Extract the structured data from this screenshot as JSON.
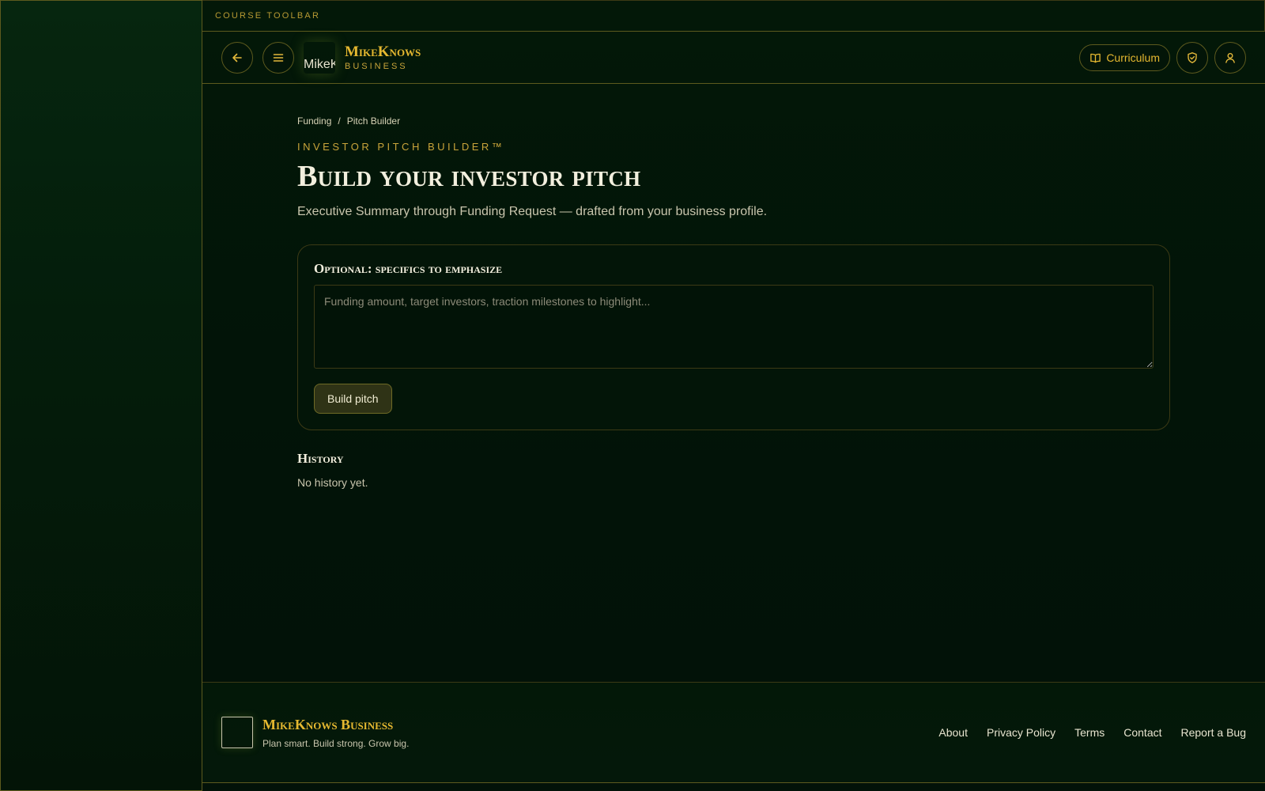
{
  "toolbar": {
    "label": "COURSE TOOLBAR"
  },
  "header": {
    "logo_alt": "MikeKnows",
    "brand_name": "MikeKnows",
    "brand_sub": "BUSINESS",
    "curriculum_label": "Curriculum",
    "icons": [
      "arrow-left-icon",
      "menu-icon",
      "book-icon",
      "shield-check-icon",
      "user-icon"
    ]
  },
  "breadcrumb": {
    "items": [
      "Funding",
      "Pitch Builder"
    ],
    "separator": "/"
  },
  "page": {
    "eyebrow": "INVESTOR PITCH BUILDER™",
    "title": "Build your investor pitch",
    "subtitle": "Executive Summary through Funding Request — drafted from your business profile."
  },
  "form": {
    "title": "Optional: specifics to emphasize",
    "placeholder": "Funding amount, target investors, traction milestones to highlight...",
    "value": "",
    "submit_label": "Build pitch"
  },
  "history": {
    "title": "History",
    "empty_text": "No history yet."
  },
  "footer": {
    "brand_name": "MikeKnows Business",
    "tagline": "Plan smart. Build strong. Grow big.",
    "links": [
      "About",
      "Privacy Policy",
      "Terms",
      "Contact",
      "Report a Bug"
    ]
  },
  "colors": {
    "accent": "#e5b830",
    "background": "#021308",
    "border": "#5d5a1e"
  }
}
